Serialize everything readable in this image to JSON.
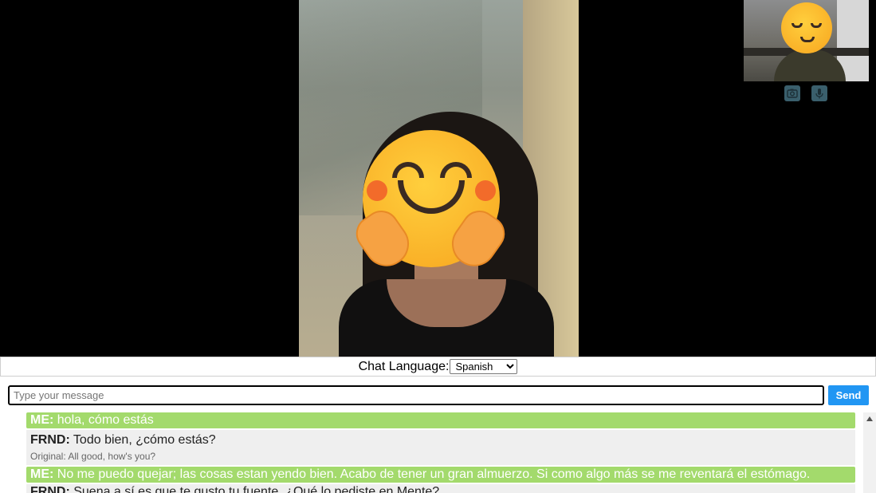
{
  "video": {
    "remote_label": "remote video",
    "self_label": "self view"
  },
  "controls": {
    "camera_icon": "camera-icon",
    "mic_icon": "microphone-icon"
  },
  "language": {
    "label": "Chat Language:",
    "selected": "Spanish"
  },
  "composer": {
    "placeholder": "Type your message",
    "send_label": "Send"
  },
  "messages": [
    {
      "sender": "ME:",
      "text": "hola, cómo estás"
    },
    {
      "sender": "FRND:",
      "text": "Todo bien, ¿cómo estás?",
      "original": "Original: All good, how's you?"
    },
    {
      "sender": "ME:",
      "text": "No me puedo quejar; las cosas estan yendo bien. Acabo de tener un gran almuerzo. Si como algo más se me reventará el estómago."
    },
    {
      "sender": "FRND:",
      "text": "Suena a sí es que te gusto tu fuente. ¿Qué lo pediste en Mente?"
    }
  ],
  "colors": {
    "me_bg": "#a3da6c",
    "frnd_bg": "#efefef",
    "send_bg": "#2196f3"
  }
}
